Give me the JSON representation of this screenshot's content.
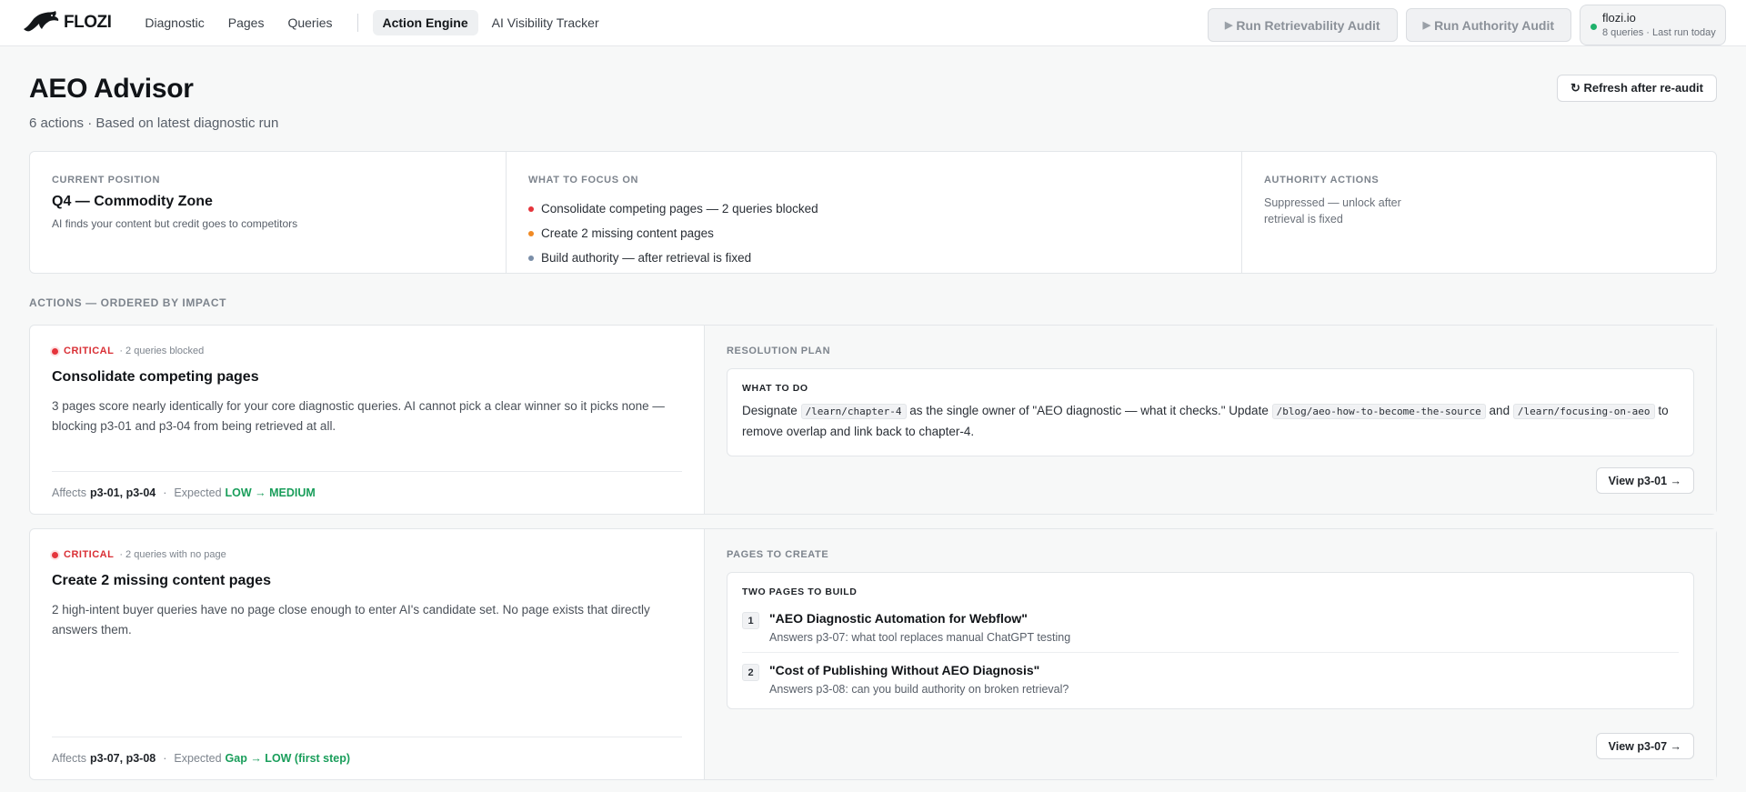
{
  "brand": {
    "name": "FLOZI"
  },
  "nav": {
    "items": [
      "Diagnostic",
      "Pages",
      "Queries"
    ],
    "secondary": [
      "Action Engine",
      "AI Visibility Tracker"
    ],
    "active": "Action Engine"
  },
  "toolbar": {
    "retrievability_label": "Run Retrievability Audit",
    "authority_label": "Run Authority Audit"
  },
  "site": {
    "name": "flozi.io",
    "meta": "8 queries · Last run today",
    "status_color": "#1fb16b"
  },
  "header": {
    "title": "AEO Advisor",
    "subtitle": "6 actions · Based on latest diagnostic run",
    "refresh_label": "↻ Refresh after re-audit"
  },
  "summary": {
    "position": {
      "label": "CURRENT POSITION",
      "title": "Q4 — Commodity Zone",
      "desc": "AI finds your content but credit goes to competitors"
    },
    "focus": {
      "label": "WHAT TO FOCUS ON",
      "items": [
        {
          "text": "Consolidate competing pages — 2 queries blocked",
          "color": "#e5343b"
        },
        {
          "text": "Create 2 missing content pages",
          "color": "#f08a24"
        },
        {
          "text": "Build authority — after retrieval is fixed",
          "color": "#7a8ea8"
        }
      ]
    },
    "authority": {
      "label": "AUTHORITY ACTIONS",
      "text": "Suppressed — unlock after retrieval is fixed"
    }
  },
  "section_label": "ACTIONS — ORDERED BY IMPACT",
  "actions": [
    {
      "severity": "CRITICAL",
      "note": "· 2 queries blocked",
      "title": "Consolidate competing pages",
      "desc": "3 pages score nearly identically for your core diagnostic queries. AI cannot pick a clear winner so it picks none — blocking p3-01 and p3-04 from being retrieved at all.",
      "affects_label": "Affects",
      "affects": "p3-01, p3-04",
      "expected_label": "Expected",
      "expected": "LOW → MEDIUM",
      "panel_label": "RESOLUTION PLAN",
      "plan_head": "WHAT TO DO",
      "plan": {
        "t1": "Designate",
        "c1": "/learn/chapter-4",
        "t2": "as the single owner of \"AEO diagnostic — what it checks.\" Update",
        "c2": "/blog/aeo-how-to-become-the-source",
        "t3": "and",
        "c3": "/learn/focusing-on-aeo",
        "t4": "to remove overlap and link back to chapter-4."
      },
      "view_label": "View p3-01 →"
    },
    {
      "severity": "CRITICAL",
      "note": "· 2 queries with no page",
      "title": "Create 2 missing content pages",
      "desc": "2 high-intent buyer queries have no page close enough to enter AI's candidate set. No page exists that directly answers them.",
      "affects_label": "Affects",
      "affects": "p3-07, p3-08",
      "expected_label": "Expected",
      "expected": "Gap → LOW (first step)",
      "panel_label": "PAGES TO CREATE",
      "plan_head": "TWO PAGES TO BUILD",
      "pages": [
        {
          "num": "1",
          "title": "\"AEO Diagnostic Automation for Webflow\"",
          "sub": "Answers p3-07: what tool replaces manual ChatGPT testing"
        },
        {
          "num": "2",
          "title": "\"Cost of Publishing Without AEO Diagnosis\"",
          "sub": "Answers p3-08: can you build authority on broken retrieval?"
        }
      ],
      "view_label": "View p3-07 →"
    }
  ]
}
